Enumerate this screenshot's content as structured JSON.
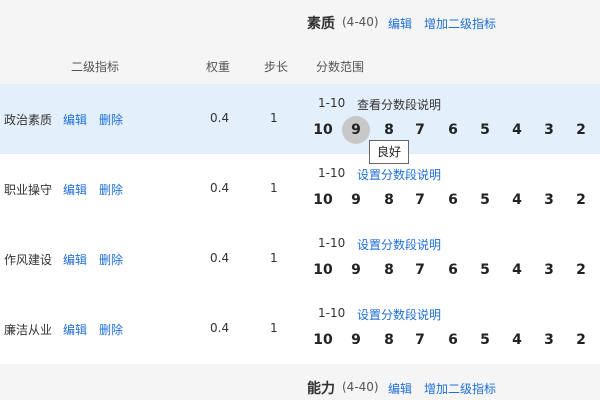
{
  "sections": [
    {
      "title": "素质",
      "range": "(4-40)",
      "edit": "编辑",
      "add": "增加二级指标"
    },
    {
      "title": "能力",
      "range": "(4-40)",
      "edit": "编辑",
      "add": "增加二级指标"
    }
  ],
  "columns": {
    "sub_indicator": "二级指标",
    "weight": "权重",
    "step": "步长",
    "score_range": "分数范围"
  },
  "rows": [
    {
      "name": "政治素质",
      "edit": "编辑",
      "delete": "删除",
      "weight": "0.4",
      "step": "1",
      "range": "1-10",
      "desc": "查看分数段说明"
    },
    {
      "name": "职业操守",
      "edit": "编辑",
      "delete": "删除",
      "weight": "0.4",
      "step": "1",
      "range": "1-10",
      "desc": "设置分数段说明"
    },
    {
      "name": "作风建设",
      "edit": "编辑",
      "delete": "删除",
      "weight": "0.4",
      "step": "1",
      "range": "1-10",
      "desc": "设置分数段说明"
    },
    {
      "name": "廉洁从业",
      "edit": "编辑",
      "delete": "删除",
      "weight": "0.4",
      "step": "1",
      "range": "1-10",
      "desc": "设置分数段说明"
    }
  ],
  "scores": [
    "10",
    "9",
    "8",
    "7",
    "6",
    "5",
    "4",
    "3",
    "2"
  ],
  "selected": {
    "row": 0,
    "score": "9"
  },
  "tooltip": "良好",
  "colors": {
    "link": "#1e6fd9",
    "active_row": "#e3f0fc",
    "header_bg": "#f5f5f5",
    "selected_score": "#c8c8c8"
  }
}
